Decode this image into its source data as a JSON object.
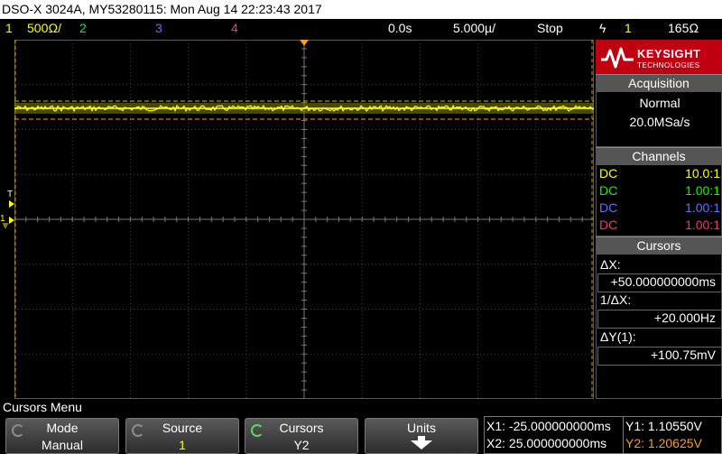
{
  "title_bar": "DSO-X 3024A, MY53280115: Mon Aug 14 22:23:43 2017",
  "status": {
    "ch1_num": "1",
    "ch1_scale": "500Ω/",
    "ch2_num": "2",
    "ch3_num": "3",
    "ch4_num": "4",
    "time_delay": "0.0s",
    "time_scale": "5.000µ/",
    "run_state": "Stop",
    "trig_icon": "ϟ",
    "trig_source": "1",
    "trig_level": "165Ω",
    "colors": {
      "ch1": "#ffff00",
      "ch2": "#00ff00",
      "ch3": "#6070ff",
      "ch4": "#ff3070"
    }
  },
  "logo": {
    "name": "KEYSIGHT",
    "sub": "TECHNOLOGIES"
  },
  "acquisition": {
    "header": "Acquisition",
    "mode": "Normal",
    "rate": "20.0MSa/s"
  },
  "channels": {
    "header": "Channels",
    "rows": [
      {
        "coupling": "DC",
        "probe": "10.0:1",
        "color": "#ffff00"
      },
      {
        "coupling": "DC",
        "probe": "1.00:1",
        "color": "#00ff00"
      },
      {
        "coupling": "DC",
        "probe": "1.00:1",
        "color": "#6070ff"
      },
      {
        "coupling": "DC",
        "probe": "1.00:1",
        "color": "#ff3070"
      }
    ]
  },
  "cursors": {
    "header": "Cursors",
    "dx_label": "ΔX:",
    "dx_value": "+50.000000000ms",
    "inv_dx_label": "1/ΔX:",
    "inv_dx_value": "+20.000Hz",
    "dy_label": "ΔY(1):",
    "dy_value": "+100.75mV"
  },
  "menu_title": "Cursors Menu",
  "softkeys": [
    {
      "top": "Mode",
      "bottom": "Manual"
    },
    {
      "top": "Source",
      "bottom": "1"
    },
    {
      "top": "Cursors",
      "bottom": "Y2"
    },
    {
      "top": "Units",
      "bottom": ""
    }
  ],
  "readout": {
    "x1": "X1: -25.000000000ms",
    "x2": "X2: 25.000000000ms",
    "y1": "Y1: 1.10550V",
    "y2": "Y2: 1.20625V"
  },
  "markers": {
    "trigger": "T",
    "ground": "1"
  }
}
